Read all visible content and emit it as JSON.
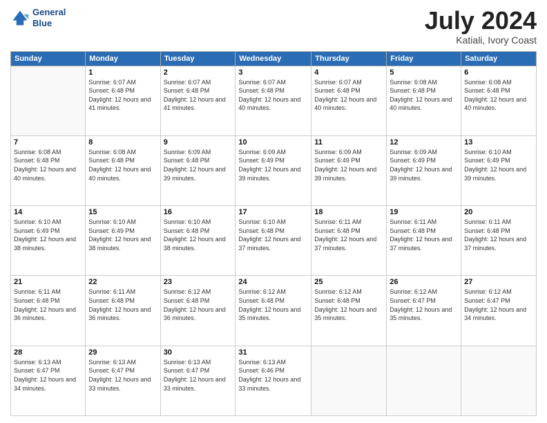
{
  "header": {
    "logo_line1": "General",
    "logo_line2": "Blue",
    "month_year": "July 2024",
    "location": "Katiali, Ivory Coast"
  },
  "days_of_week": [
    "Sunday",
    "Monday",
    "Tuesday",
    "Wednesday",
    "Thursday",
    "Friday",
    "Saturday"
  ],
  "weeks": [
    [
      {
        "day": "",
        "sunrise": "",
        "sunset": "",
        "daylight": ""
      },
      {
        "day": "1",
        "sunrise": "Sunrise: 6:07 AM",
        "sunset": "Sunset: 6:48 PM",
        "daylight": "Daylight: 12 hours and 41 minutes."
      },
      {
        "day": "2",
        "sunrise": "Sunrise: 6:07 AM",
        "sunset": "Sunset: 6:48 PM",
        "daylight": "Daylight: 12 hours and 41 minutes."
      },
      {
        "day": "3",
        "sunrise": "Sunrise: 6:07 AM",
        "sunset": "Sunset: 6:48 PM",
        "daylight": "Daylight: 12 hours and 40 minutes."
      },
      {
        "day": "4",
        "sunrise": "Sunrise: 6:07 AM",
        "sunset": "Sunset: 6:48 PM",
        "daylight": "Daylight: 12 hours and 40 minutes."
      },
      {
        "day": "5",
        "sunrise": "Sunrise: 6:08 AM",
        "sunset": "Sunset: 6:48 PM",
        "daylight": "Daylight: 12 hours and 40 minutes."
      },
      {
        "day": "6",
        "sunrise": "Sunrise: 6:08 AM",
        "sunset": "Sunset: 6:48 PM",
        "daylight": "Daylight: 12 hours and 40 minutes."
      }
    ],
    [
      {
        "day": "7",
        "sunrise": "Sunrise: 6:08 AM",
        "sunset": "Sunset: 6:48 PM",
        "daylight": "Daylight: 12 hours and 40 minutes."
      },
      {
        "day": "8",
        "sunrise": "Sunrise: 6:08 AM",
        "sunset": "Sunset: 6:48 PM",
        "daylight": "Daylight: 12 hours and 40 minutes."
      },
      {
        "day": "9",
        "sunrise": "Sunrise: 6:09 AM",
        "sunset": "Sunset: 6:48 PM",
        "daylight": "Daylight: 12 hours and 39 minutes."
      },
      {
        "day": "10",
        "sunrise": "Sunrise: 6:09 AM",
        "sunset": "Sunset: 6:49 PM",
        "daylight": "Daylight: 12 hours and 39 minutes."
      },
      {
        "day": "11",
        "sunrise": "Sunrise: 6:09 AM",
        "sunset": "Sunset: 6:49 PM",
        "daylight": "Daylight: 12 hours and 39 minutes."
      },
      {
        "day": "12",
        "sunrise": "Sunrise: 6:09 AM",
        "sunset": "Sunset: 6:49 PM",
        "daylight": "Daylight: 12 hours and 39 minutes."
      },
      {
        "day": "13",
        "sunrise": "Sunrise: 6:10 AM",
        "sunset": "Sunset: 6:49 PM",
        "daylight": "Daylight: 12 hours and 39 minutes."
      }
    ],
    [
      {
        "day": "14",
        "sunrise": "Sunrise: 6:10 AM",
        "sunset": "Sunset: 6:49 PM",
        "daylight": "Daylight: 12 hours and 38 minutes."
      },
      {
        "day": "15",
        "sunrise": "Sunrise: 6:10 AM",
        "sunset": "Sunset: 6:49 PM",
        "daylight": "Daylight: 12 hours and 38 minutes."
      },
      {
        "day": "16",
        "sunrise": "Sunrise: 6:10 AM",
        "sunset": "Sunset: 6:48 PM",
        "daylight": "Daylight: 12 hours and 38 minutes."
      },
      {
        "day": "17",
        "sunrise": "Sunrise: 6:10 AM",
        "sunset": "Sunset: 6:48 PM",
        "daylight": "Daylight: 12 hours and 37 minutes."
      },
      {
        "day": "18",
        "sunrise": "Sunrise: 6:11 AM",
        "sunset": "Sunset: 6:48 PM",
        "daylight": "Daylight: 12 hours and 37 minutes."
      },
      {
        "day": "19",
        "sunrise": "Sunrise: 6:11 AM",
        "sunset": "Sunset: 6:48 PM",
        "daylight": "Daylight: 12 hours and 37 minutes."
      },
      {
        "day": "20",
        "sunrise": "Sunrise: 6:11 AM",
        "sunset": "Sunset: 6:48 PM",
        "daylight": "Daylight: 12 hours and 37 minutes."
      }
    ],
    [
      {
        "day": "21",
        "sunrise": "Sunrise: 6:11 AM",
        "sunset": "Sunset: 6:48 PM",
        "daylight": "Daylight: 12 hours and 36 minutes."
      },
      {
        "day": "22",
        "sunrise": "Sunrise: 6:11 AM",
        "sunset": "Sunset: 6:48 PM",
        "daylight": "Daylight: 12 hours and 36 minutes."
      },
      {
        "day": "23",
        "sunrise": "Sunrise: 6:12 AM",
        "sunset": "Sunset: 6:48 PM",
        "daylight": "Daylight: 12 hours and 36 minutes."
      },
      {
        "day": "24",
        "sunrise": "Sunrise: 6:12 AM",
        "sunset": "Sunset: 6:48 PM",
        "daylight": "Daylight: 12 hours and 35 minutes."
      },
      {
        "day": "25",
        "sunrise": "Sunrise: 6:12 AM",
        "sunset": "Sunset: 6:48 PM",
        "daylight": "Daylight: 12 hours and 35 minutes."
      },
      {
        "day": "26",
        "sunrise": "Sunrise: 6:12 AM",
        "sunset": "Sunset: 6:47 PM",
        "daylight": "Daylight: 12 hours and 35 minutes."
      },
      {
        "day": "27",
        "sunrise": "Sunrise: 6:12 AM",
        "sunset": "Sunset: 6:47 PM",
        "daylight": "Daylight: 12 hours and 34 minutes."
      }
    ],
    [
      {
        "day": "28",
        "sunrise": "Sunrise: 6:13 AM",
        "sunset": "Sunset: 6:47 PM",
        "daylight": "Daylight: 12 hours and 34 minutes."
      },
      {
        "day": "29",
        "sunrise": "Sunrise: 6:13 AM",
        "sunset": "Sunset: 6:47 PM",
        "daylight": "Daylight: 12 hours and 33 minutes."
      },
      {
        "day": "30",
        "sunrise": "Sunrise: 6:13 AM",
        "sunset": "Sunset: 6:47 PM",
        "daylight": "Daylight: 12 hours and 33 minutes."
      },
      {
        "day": "31",
        "sunrise": "Sunrise: 6:13 AM",
        "sunset": "Sunset: 6:46 PM",
        "daylight": "Daylight: 12 hours and 33 minutes."
      },
      {
        "day": "",
        "sunrise": "",
        "sunset": "",
        "daylight": ""
      },
      {
        "day": "",
        "sunrise": "",
        "sunset": "",
        "daylight": ""
      },
      {
        "day": "",
        "sunrise": "",
        "sunset": "",
        "daylight": ""
      }
    ]
  ]
}
